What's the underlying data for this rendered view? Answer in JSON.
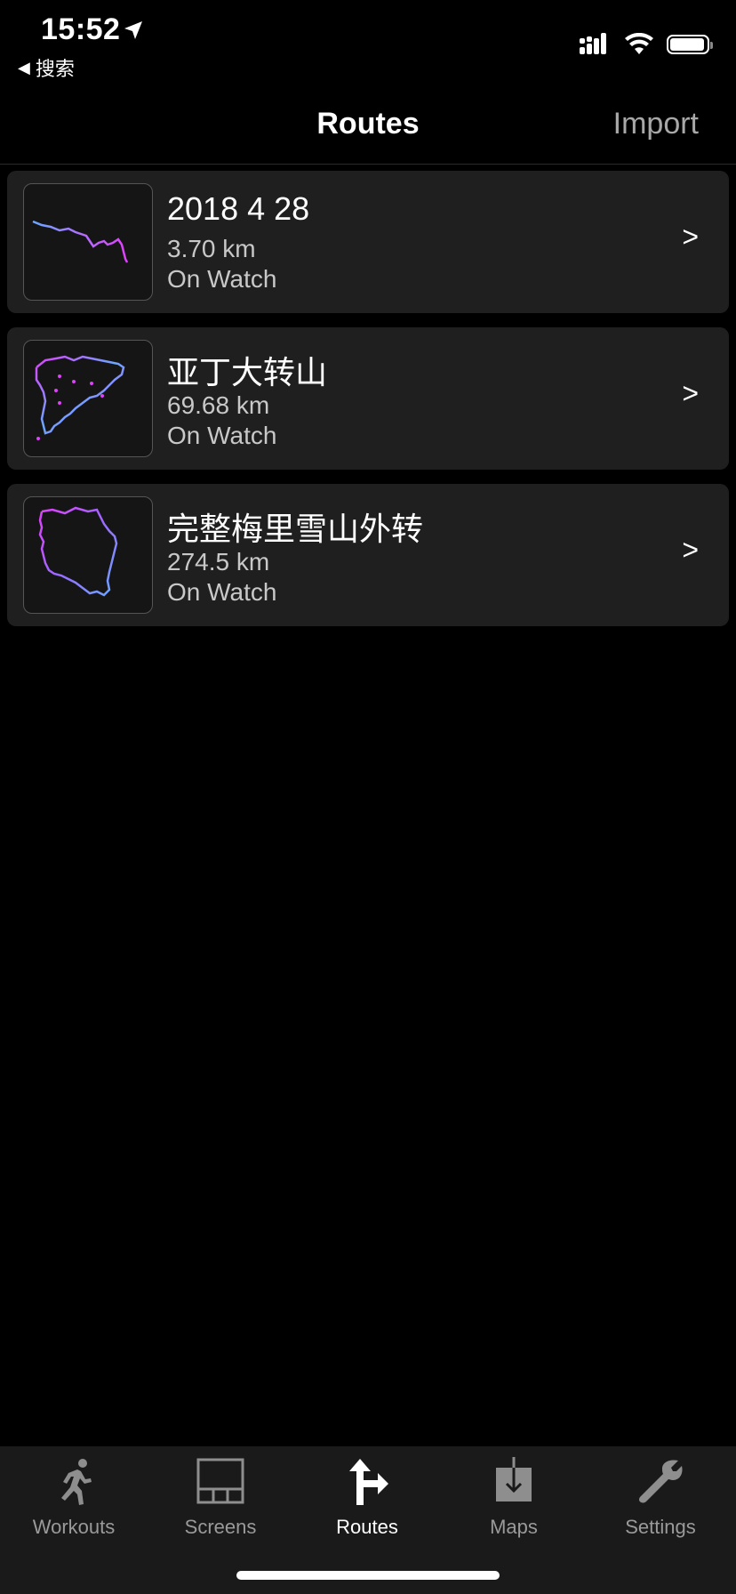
{
  "status_bar": {
    "time": "15:52",
    "back_label": "搜索"
  },
  "nav": {
    "title": "Routes",
    "import_label": "Import"
  },
  "routes": [
    {
      "name": "2018 4 28",
      "distance": "3.70 km",
      "location": "On Watch",
      "chevron": ">"
    },
    {
      "name": "亚丁大转山",
      "distance": "69.68 km",
      "location": "On Watch",
      "chevron": ">"
    },
    {
      "name": "完整梅里雪山外转",
      "distance": "274.5 km",
      "location": "On Watch",
      "chevron": ">"
    }
  ],
  "tabs": [
    {
      "label": "Workouts",
      "icon": "running-person-icon",
      "active": false
    },
    {
      "label": "Screens",
      "icon": "screens-layout-icon",
      "active": false
    },
    {
      "label": "Routes",
      "icon": "route-turn-arrow-icon",
      "active": true
    },
    {
      "label": "Maps",
      "icon": "map-download-icon",
      "active": false
    },
    {
      "label": "Settings",
      "icon": "wrench-icon",
      "active": false
    }
  ],
  "colors": {
    "background": "#000000",
    "card": "#1f1f1f",
    "tab_bar": "#1a1a1a",
    "route_line_a": "#6aa8ff",
    "route_line_b": "#e040fb",
    "inactive_text": "#9a9a9a"
  }
}
